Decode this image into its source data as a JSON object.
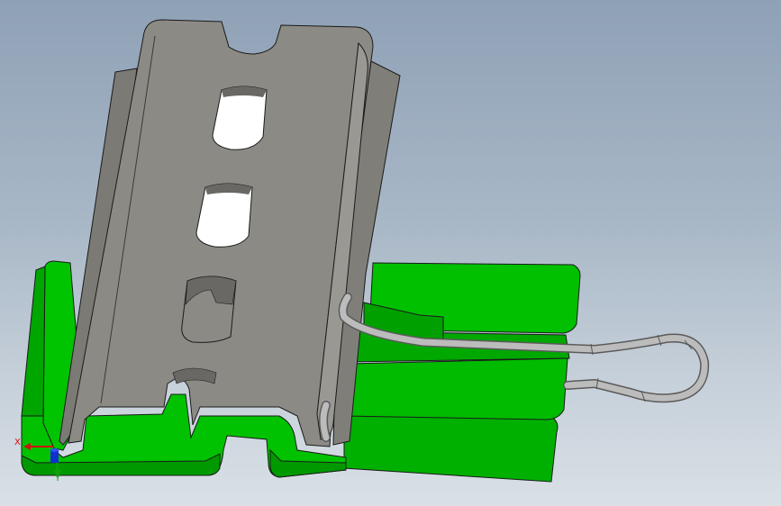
{
  "viewport": {
    "background_top": "#8fa1b6",
    "background_bottom": "#d9e0e6"
  },
  "model": {
    "rail_color": "#8c8a84",
    "rail_shadow_color": "#6f6d68",
    "clip_color": "#00b800",
    "clip_dark_color": "#009100",
    "spring_color": "#b4b4b4",
    "edge_color": "#1a1a1a"
  },
  "triad": {
    "x_label": "X",
    "y_label": "Y",
    "x_color": "#d01010",
    "y_color": "#10a010",
    "z_color": "#1030d0"
  }
}
